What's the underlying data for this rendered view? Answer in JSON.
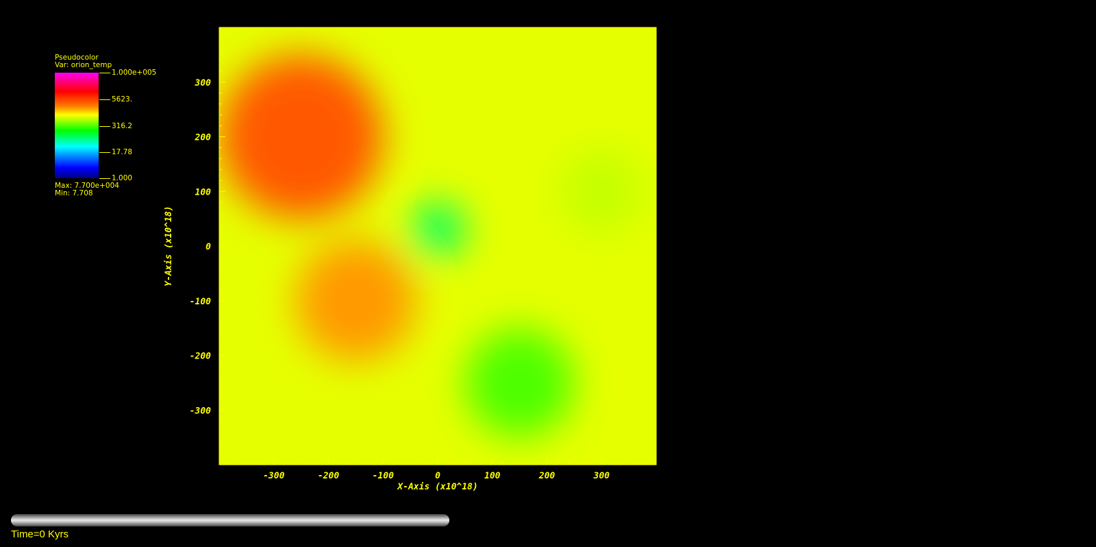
{
  "legend": {
    "plot_type": "Pseudocolor",
    "variable": "Var: orion_temp",
    "ticks": [
      "1.000e+005",
      "5623.",
      "316.2",
      "17.78",
      "1.000"
    ],
    "max_text": "Max:  7.700e+004",
    "min_text": "Min:  7.708",
    "colors": [
      "#ff00ff",
      "#ff0000",
      "#ffff00",
      "#00ff00",
      "#00ffff",
      "#0000ff"
    ]
  },
  "chart_data": {
    "type": "heatmap",
    "variable": "orion_temp",
    "color_scale": "log",
    "value_range": [
      1.0,
      100000.0
    ],
    "data_range": {
      "max": 77000,
      "min": 7.708
    },
    "xlabel": "X-Axis  (x10^18)",
    "ylabel": "Y-Axis  (x10^18)",
    "xlim": [
      -400,
      400
    ],
    "ylim": [
      -400,
      400
    ],
    "x_ticks": [
      -300,
      -200,
      -100,
      0,
      100,
      200,
      300
    ],
    "y_ticks": [
      300,
      200,
      100,
      0,
      -100,
      -200,
      -300
    ],
    "features": [
      {
        "x": -250,
        "y": 200,
        "r": 150,
        "value": 4500
      },
      {
        "x": -150,
        "y": -100,
        "r": 110,
        "value": 2500
      },
      {
        "x": 150,
        "y": -250,
        "r": 100,
        "value": 200
      },
      {
        "x": 0,
        "y": 30,
        "r": 50,
        "value": 40
      },
      {
        "x": 300,
        "y": 100,
        "r": 80,
        "value": 600
      }
    ]
  },
  "footer": {
    "time_label": "Time=0 Kyrs"
  }
}
